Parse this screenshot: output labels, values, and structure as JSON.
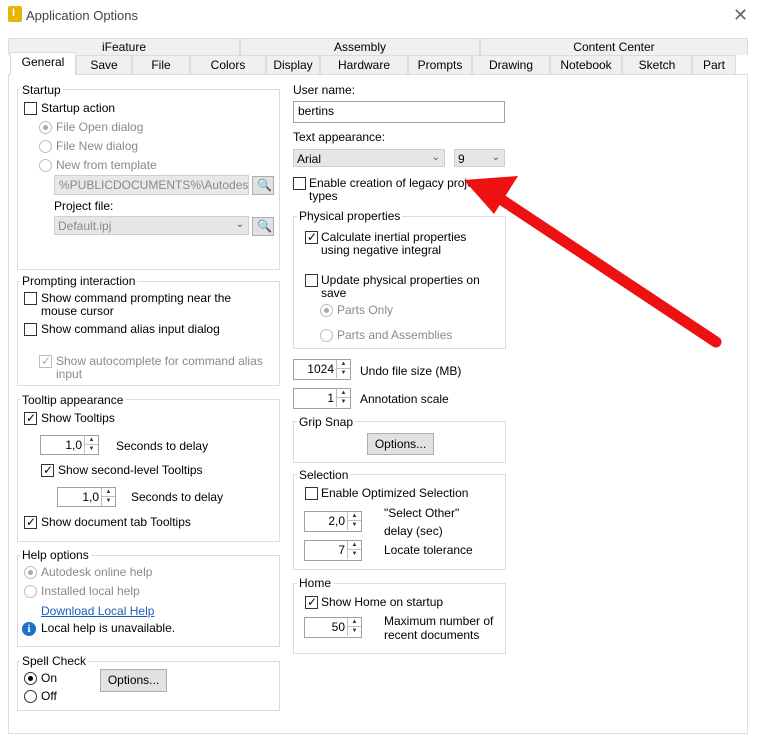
{
  "window": {
    "title": "Application Options"
  },
  "tabs_top": [
    "iFeature",
    "Assembly",
    "Content Center"
  ],
  "tabs": [
    "General",
    "Save",
    "File",
    "Colors",
    "Display",
    "Hardware",
    "Prompts",
    "Drawing",
    "Notebook",
    "Sketch",
    "Part"
  ],
  "startup": {
    "title": "Startup",
    "startup_action": "Startup action",
    "file_open": "File Open dialog",
    "file_new": "File New dialog",
    "new_template": "New from template",
    "template_path": "%PUBLICDOCUMENTS%\\Autodesk",
    "project_file_label": "Project file:",
    "project_file": "Default.ipj"
  },
  "prompting": {
    "title": "Prompting interaction",
    "show_cmd_prompting": "Show command prompting near the mouse cursor",
    "show_alias": "Show command alias input dialog",
    "show_autocomplete": "Show autocomplete for command alias input"
  },
  "tooltip": {
    "title": "Tooltip appearance",
    "show_tooltips": "Show Tooltips",
    "delay1": "1,0",
    "seconds_to_delay": "Seconds to delay",
    "second_level": "Show second-level Tooltips",
    "delay2": "1,0",
    "doc_tab": "Show document tab Tooltips"
  },
  "help": {
    "title": "Help options",
    "online": "Autodesk online help",
    "local": "Installed local help",
    "download": "Download Local Help",
    "unavailable": "Local help is unavailable."
  },
  "spell": {
    "title": "Spell Check",
    "on": "On",
    "off": "Off",
    "options": "Options..."
  },
  "user": {
    "label": "User name:",
    "value": "bertins"
  },
  "text_appearance": {
    "label": "Text appearance:",
    "font": "Arial",
    "size": "9"
  },
  "legacy": "Enable creation of legacy project types",
  "physical": {
    "title": "Physical properties",
    "calc_inertial": "Calculate inertial properties using negative integral",
    "update_on_save": "Update physical properties on save",
    "parts_only": "Parts Only",
    "parts_assemblies": "Parts and Assemblies"
  },
  "undo": {
    "value": "1024",
    "label": "Undo file size (MB)"
  },
  "annotation": {
    "value": "1",
    "label": "Annotation scale"
  },
  "grip": {
    "title": "Grip Snap",
    "options": "Options..."
  },
  "selection": {
    "title": "Selection",
    "optimized": "Enable Optimized Selection",
    "select_other_value": "2,0",
    "select_other_label1": "\"Select Other\"",
    "select_other_label2": "delay (sec)",
    "locate_value": "7",
    "locate_label": "Locate tolerance"
  },
  "home": {
    "title": "Home",
    "show_home": "Show Home on startup",
    "max_value": "50",
    "max_label1": "Maximum number of",
    "max_label2": "recent documents"
  },
  "colors": {
    "arrow": "#ee1111",
    "accent": "#1e6fd1"
  }
}
